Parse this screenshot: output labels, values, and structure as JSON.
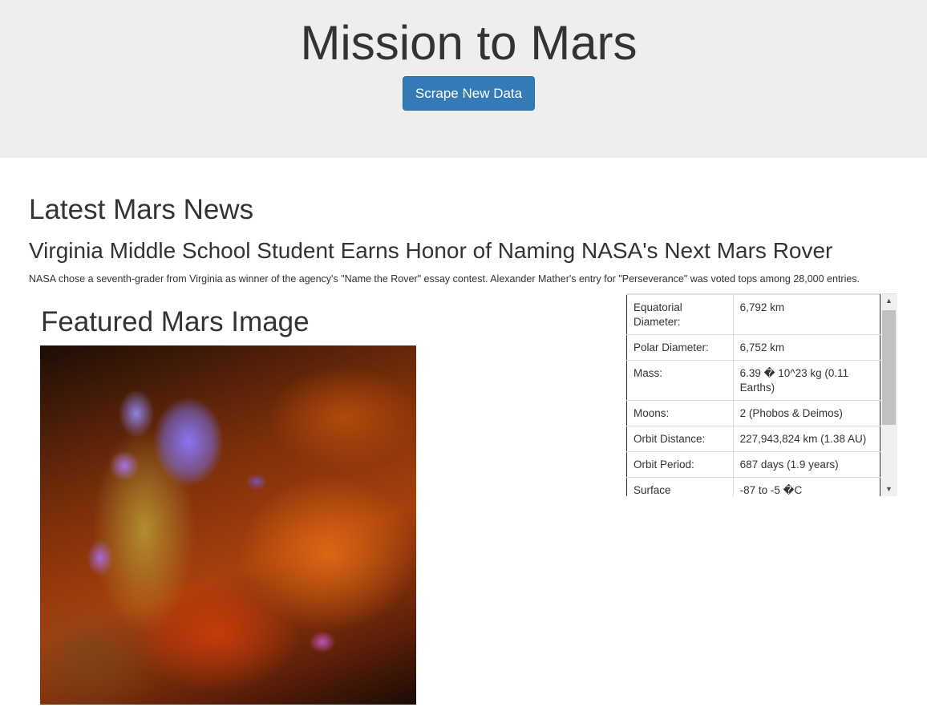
{
  "header": {
    "title": "Mission to Mars",
    "scrape_button_label": "Scrape New Data"
  },
  "news": {
    "section_heading": "Latest Mars News",
    "title": "Virginia Middle School Student Earns Honor of Naming NASA's Next Mars Rover",
    "paragraph": "NASA chose a seventh-grader from Virginia as winner of the agency's \"Name the Rover\" essay contest. Alexander Mather's entry for \"Perseverance\" was voted tops among 28,000 entries."
  },
  "featured": {
    "section_heading": "Featured Mars Image"
  },
  "facts": {
    "rows": [
      {
        "label": "Equatorial Diameter:",
        "value": "6,792 km"
      },
      {
        "label": "Polar Diameter:",
        "value": "6,752 km"
      },
      {
        "label": "Mass:",
        "value": "6.39 � 10^23 kg (0.11 Earths)"
      },
      {
        "label": "Moons:",
        "value": "2 (Phobos & Deimos)"
      },
      {
        "label": "Orbit Distance:",
        "value": "227,943,824 km (1.38 AU)"
      },
      {
        "label": "Orbit Period:",
        "value": "687 days (1.9 years)"
      },
      {
        "label": "Surface",
        "value": "-87 to -5 �C"
      }
    ]
  },
  "icons": {
    "scroll_up": "triangle-up-icon",
    "scroll_down": "triangle-down-icon"
  }
}
